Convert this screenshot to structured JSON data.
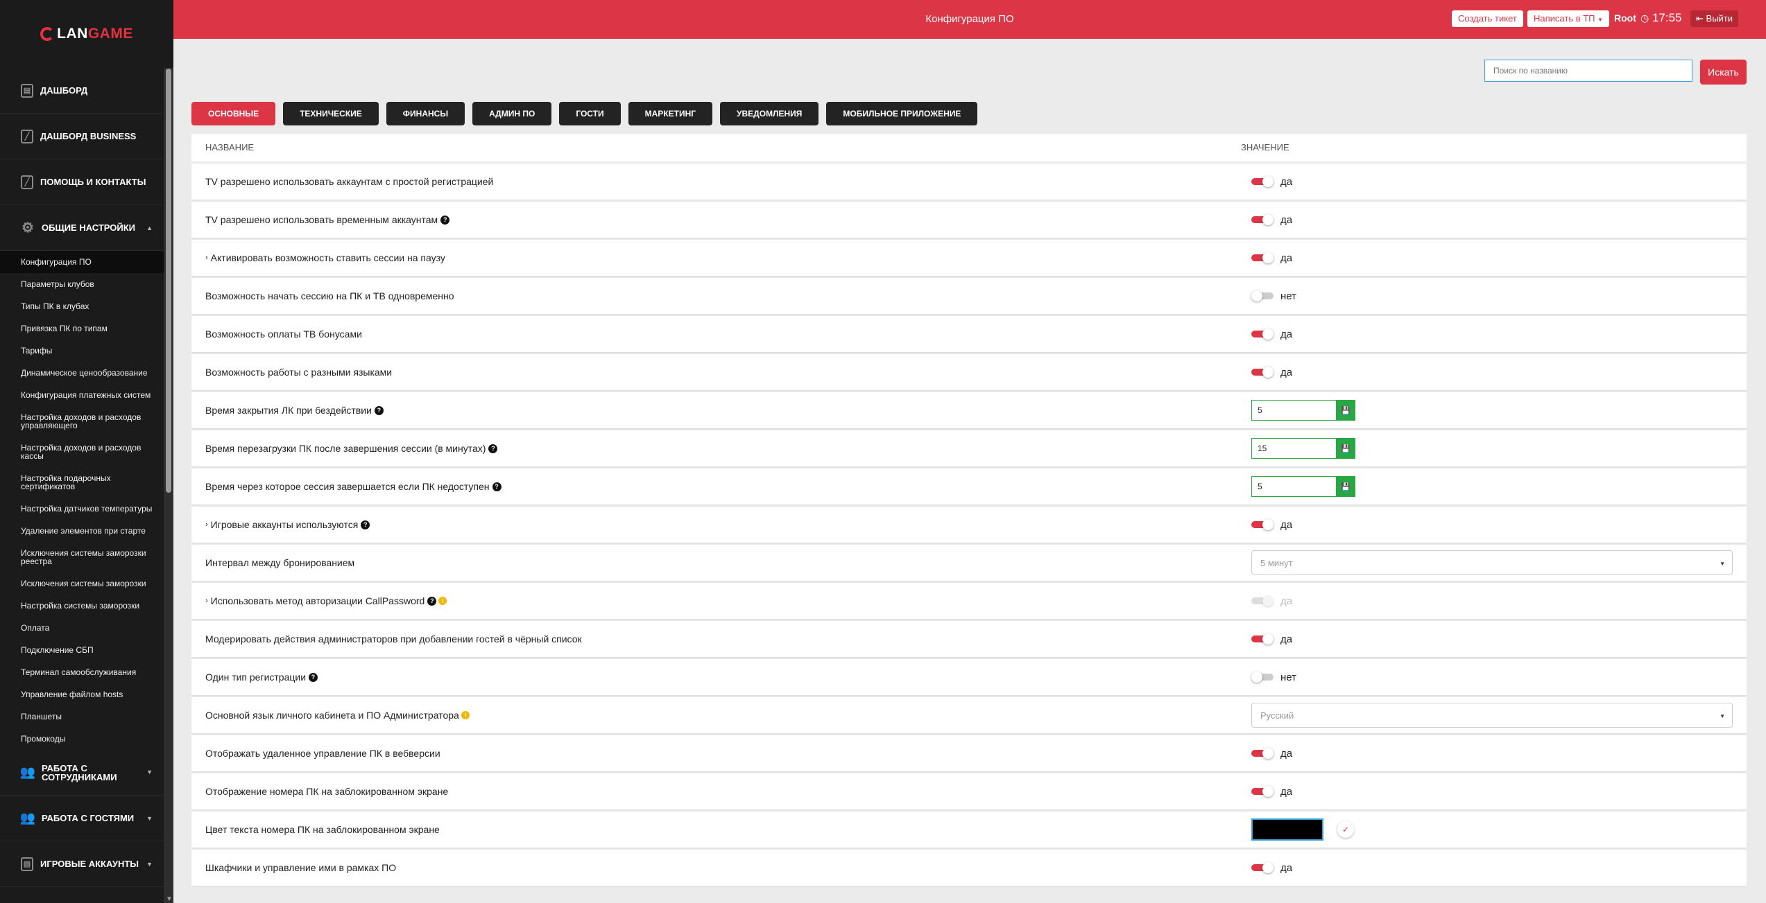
{
  "brand": {
    "name_part1": "LAN",
    "name_part2": "GAME"
  },
  "header": {
    "title": "Конфигурация ПО",
    "create_ticket": "Создать тикет",
    "write_support": "Написать в ТП",
    "user": "Root",
    "time": "17:55",
    "logout": "Выйти"
  },
  "sidebar": {
    "main_top": [
      {
        "label": "ДАШБОРД"
      },
      {
        "label": "ДАШБОРД BUSINESS"
      },
      {
        "label": "ПОМОЩЬ И КОНТАКТЫ"
      },
      {
        "label": "ОБЩИЕ НАСТРОЙКИ"
      }
    ],
    "sub": [
      "Конфигурация ПО",
      "Параметры клубов",
      "Типы ПК в клубах",
      "Привязка ПК по типам",
      "Тарифы",
      "Динамическое ценообразование",
      "Конфигурация платежных систем",
      "Настройка доходов и расходов управляющего",
      "Настройка доходов и расходов кассы",
      "Настройка подарочных сертификатов",
      "Настройка датчиков температуры",
      "Удаление элементов при старте",
      "Исключения системы заморозки реестра",
      "Исключения системы заморозки",
      "Настройка системы заморозки",
      "Оплата",
      "Подключение СБП",
      "Терминал самообслуживания",
      "Управление файлом hosts",
      "Планшеты",
      "Промокоды"
    ],
    "main_bottom": [
      {
        "label": "РАБОТА С СОТРУДНИКАМИ"
      },
      {
        "label": "РАБОТА С ГОСТЯМИ"
      },
      {
        "label": "ИГРОВЫЕ АККАУНТЫ"
      }
    ]
  },
  "search": {
    "placeholder": "Поиск по названию",
    "button": "Искать"
  },
  "tabs": [
    "ОСНОВНЫЕ",
    "ТЕХНИЧЕСКИЕ",
    "ФИНАНСЫ",
    "АДМИН ПО",
    "ГОСТИ",
    "МАРКЕТИНГ",
    "УВЕДОМЛЕНИЯ",
    "МОБИЛЬНОЕ ПРИЛОЖЕНИЕ"
  ],
  "table": {
    "col_name": "НАЗВАНИЕ",
    "col_value": "ЗНАЧЕНИЕ",
    "rows": [
      {
        "name": "TV разрешено использовать аккаунтам с простой регистрацией",
        "value": "да"
      },
      {
        "name": "TV разрешено использовать временным аккаунтам",
        "value": "да"
      },
      {
        "name": "Активировать возможность ставить сессии на паузу",
        "value": "да"
      },
      {
        "name": "Возможность начать сессию на ПК и ТВ одновременно",
        "value": "нет"
      },
      {
        "name": "Возможность оплаты ТВ бонусами",
        "value": "да"
      },
      {
        "name": "Возможность работы с разными языками",
        "value": "да"
      },
      {
        "name": "Время закрытия ЛК при бездействии",
        "value": "5"
      },
      {
        "name": "Время перезагрузки ПК после завершения сессии (в минутах)",
        "value": "15"
      },
      {
        "name": "Время через которое сессия завершается если ПК недоступен",
        "value": "5"
      },
      {
        "name": "Игровые аккаунты используются",
        "value": "да"
      },
      {
        "name": "Интервал между бронированием",
        "value": "5 минут"
      },
      {
        "name": "Использовать метод авторизации CallPassword",
        "value": "да"
      },
      {
        "name": "Модерировать действия администраторов при добавлении гостей в чёрный список",
        "value": "да"
      },
      {
        "name": "Один тип регистрации",
        "value": "нет"
      },
      {
        "name": "Основной язык личного кабинета и ПО Администратора",
        "value": "Русский"
      },
      {
        "name": "Отображать удаленное управление ПК в вебверсии",
        "value": "да"
      },
      {
        "name": "Отображение номера ПК на заблокированном экране",
        "value": "да"
      },
      {
        "name": "Цвет текста номера ПК на заблокированном экране",
        "value": "#000000"
      },
      {
        "name": "Шкафчики и управление ими в рамках ПО",
        "value": "да"
      }
    ]
  },
  "colors": {
    "accent": "#dc3545",
    "sidebar": "#1b1b1b",
    "save": "#28a745"
  }
}
